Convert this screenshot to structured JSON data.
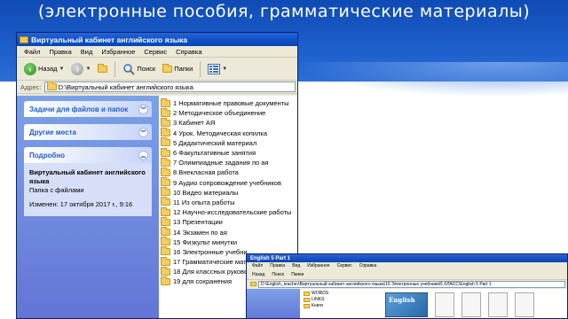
{
  "slide": {
    "title": "(электронные пособия, грамматические материалы)"
  },
  "window": {
    "title": "Виртуальный кабинет английского языка",
    "menu": [
      "Файл",
      "Правка",
      "Вид",
      "Избранное",
      "Сервис",
      "Справка"
    ],
    "toolbar": {
      "back": "Назад",
      "search": "Поиск",
      "folders": "Папки"
    },
    "address": {
      "label": "Адрес:",
      "value": "D:\\Виртуальный кабинет английского языка"
    },
    "taskpane": {
      "tasks_header": "Задачи для файлов и папок",
      "other_header": "Другие места",
      "details_header": "Подробно",
      "details_name": "Виртуальный кабинет английского языка",
      "details_type": "Папка с файлами",
      "details_modified": "Изменен: 17 октября 2017 г., 9:16"
    },
    "folders": [
      "1 Нормативные правовые документы",
      "2 Методическое объединение",
      "3 Кабинет АЯ",
      "4 Урок. Методическая копилка",
      "5 Дидактический материал",
      "6 Факультативные занятия",
      "7 Олимпиадные задания по ая",
      "8 Внекласная работа",
      "9 Аудио сопровождение учебников",
      "10 Видео материалы",
      "11 Из опыта работы",
      "12 Научно-исследовательские работы",
      "13 Презентации",
      "14 Экзамен по ая",
      "15 Физкульт минутки",
      "16 Электронные учебни",
      "17 Грамматические матер",
      "18 Для классных руково",
      "19 для сохранения"
    ]
  },
  "window2": {
    "title": "English 5 Part 1",
    "menu": [
      "Файл",
      "Правка",
      "Вид",
      "Избранное",
      "Сервис",
      "Справка"
    ],
    "toolbar": [
      "Назад",
      "Поиск",
      "Папки"
    ],
    "address": "D:\\English_teacher\\Виртуальный кабинет английского языка\\16 Электронные учебники\\5 КЛАСС\\English 5 Part 1",
    "tree": [
      "WORDS",
      "LINKS",
      "Книги"
    ],
    "book_label": "English"
  },
  "colors": {
    "slide_blue": "#1d5fcc",
    "xp_title": "#0a53c8",
    "taskpane": "#6f8be0",
    "folder": "#f4cd5d"
  }
}
